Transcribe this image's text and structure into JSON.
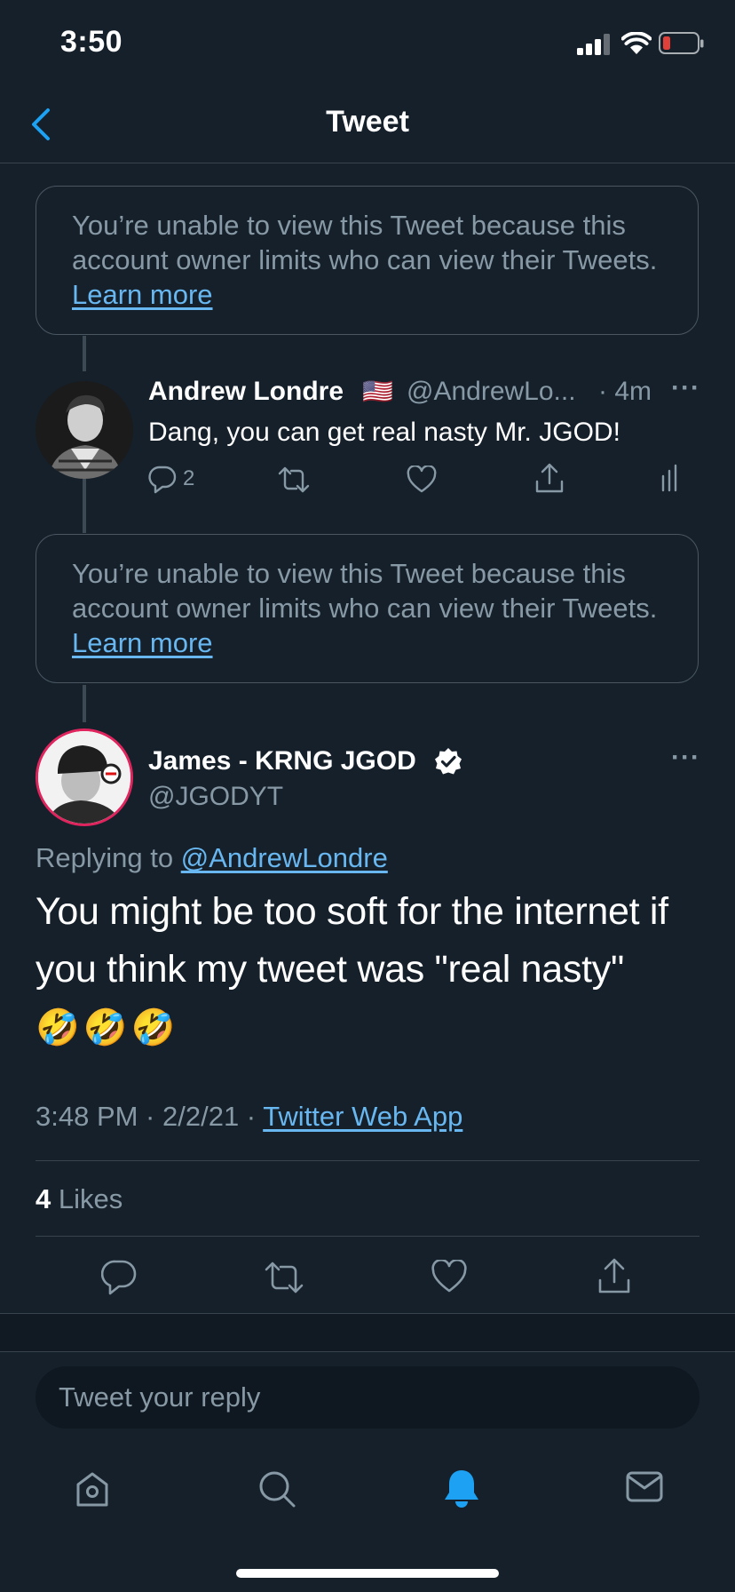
{
  "status_bar": {
    "time": "3:50"
  },
  "nav": {
    "title": "Tweet"
  },
  "restricted_notice": {
    "text": "You’re unable to view this Tweet because this account owner limits who can view their Tweets.",
    "link": "Learn more"
  },
  "reply_tweet": {
    "name": "Andrew Londre",
    "flag": "🇺🇸",
    "handle": "@AndrewLo...",
    "time": "· 4m",
    "more": "···",
    "text": "Dang, you can get real nasty Mr. JGOD!",
    "reply_count": "2"
  },
  "main_tweet": {
    "name": "James - KRNG JGOD",
    "handle": "@JGODYT",
    "more": "···",
    "replying_prefix": "Replying to",
    "replying_to": "@AndrewLondre",
    "text": "You might be too soft for the internet if you think my tweet was \"real nasty\"",
    "emojis": "🤣🤣🤣",
    "timestamp": "3:48 PM · 2/2/21 ·",
    "source": "Twitter Web App",
    "likes_count": "4",
    "likes_label": "Likes"
  },
  "reply_input": {
    "placeholder": "Tweet your reply"
  },
  "tab_bar": {
    "items": [
      "home-icon",
      "search-icon",
      "notifications-icon",
      "messages-icon"
    ],
    "active": "notifications-icon"
  },
  "colors": {
    "background": "#15202b",
    "accent": "#1da1f2",
    "link": "#68b7f0",
    "muted": "#8899a6",
    "border": "#38444d"
  }
}
